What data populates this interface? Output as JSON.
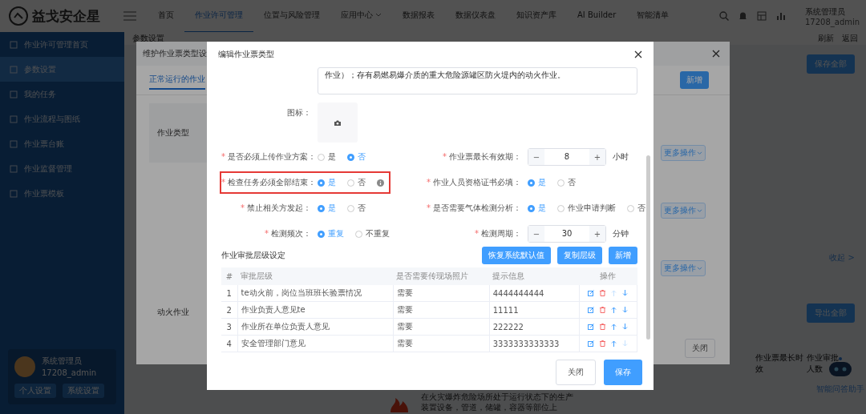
{
  "header": {
    "logo": "益戈安企星",
    "nav": [
      {
        "label": "首页",
        "selected": false,
        "dropdown": false
      },
      {
        "label": "作业许可管理",
        "selected": true,
        "dropdown": false
      },
      {
        "label": "位置与风险管理",
        "selected": false,
        "dropdown": false
      },
      {
        "label": "应用中心",
        "selected": false,
        "dropdown": true
      },
      {
        "label": "数据报表",
        "selected": false,
        "dropdown": false
      },
      {
        "label": "数据仪表盘",
        "selected": false,
        "dropdown": false
      },
      {
        "label": "知识资产库",
        "selected": false,
        "dropdown": false
      },
      {
        "label": "AI Builder",
        "selected": false,
        "dropdown": false
      },
      {
        "label": "智能清单",
        "selected": false,
        "dropdown": false
      }
    ],
    "user": {
      "name": "系统管理员",
      "account": "17208_admin"
    }
  },
  "sidebar": {
    "items": [
      {
        "label": "作业许可管理首页",
        "selected": false
      },
      {
        "label": "参数设置",
        "selected": true
      },
      {
        "label": "我的任务",
        "selected": false
      },
      {
        "label": "作业流程与图纸",
        "selected": false
      },
      {
        "label": "作业票台账",
        "selected": false
      },
      {
        "label": "作业监督管理",
        "selected": false
      },
      {
        "label": "作业票模板",
        "selected": false
      }
    ],
    "profile": {
      "name": "系统管理员",
      "account": "17208_admin",
      "links": [
        "个人设置",
        "系统设置"
      ]
    }
  },
  "page": {
    "breadcrumb": "参数设置",
    "actions": [
      "刷新",
      "返回"
    ],
    "save_all": "保存全部",
    "collapse": "收起 >",
    "export_all": "导出全部",
    "columns": [
      "作业票最长时效",
      "作业审批人数"
    ],
    "description": "在火灾爆炸危险场所处于运行状态下的生产装置设备，管道，储罐，容器等部位上",
    "assistant": "智能问答助手"
  },
  "type_dialog": {
    "title": "维护作业票类型设",
    "tab": "正常运行的作业",
    "add": "新增",
    "header_cell": "作业类型",
    "row_label": "动火作业",
    "more_actions": [
      "更多操作",
      "更多操作",
      "更多操作"
    ],
    "close": "关闭"
  },
  "edit_dialog": {
    "title": "编辑作业票类型",
    "description": "作业）；存有易燃易爆介质的重大危险源罐区防火堤内的动火作业。",
    "icon_label": "图标：",
    "required_mark": "*",
    "stepper_minus": "−",
    "stepper_plus": "+",
    "fields": [
      {
        "kind": "radio",
        "label": "是否必须上传作业方案：",
        "required": true,
        "highlighted": false,
        "info": false,
        "options": [
          {
            "label": "是",
            "selected": false
          },
          {
            "label": "否",
            "selected": true
          }
        ]
      },
      {
        "kind": "stepper",
        "label": "作业票最长有效期：",
        "required": true,
        "highlighted": false,
        "info": false,
        "value": "8",
        "unit": "小时"
      },
      {
        "kind": "radio",
        "label": "检查任务必须全部结束：",
        "required": true,
        "highlighted": true,
        "info": true,
        "options": [
          {
            "label": "是",
            "selected": true
          },
          {
            "label": "否",
            "selected": false
          }
        ]
      },
      {
        "kind": "radio",
        "label": "作业人员资格证书必填：",
        "required": true,
        "highlighted": false,
        "info": false,
        "options": [
          {
            "label": "是",
            "selected": true
          },
          {
            "label": "否",
            "selected": false
          }
        ]
      },
      {
        "kind": "radio",
        "label": "禁止相关方发起：",
        "required": true,
        "highlighted": false,
        "info": false,
        "options": [
          {
            "label": "是",
            "selected": true
          },
          {
            "label": "否",
            "selected": false
          }
        ]
      },
      {
        "kind": "radio",
        "label": "是否需要气体检测分析：",
        "required": true,
        "highlighted": false,
        "info": false,
        "options": [
          {
            "label": "是",
            "selected": true
          },
          {
            "label": "作业申请判断",
            "selected": false
          },
          {
            "label": "否",
            "selected": false
          }
        ]
      },
      {
        "kind": "radio",
        "label": "检测频次：",
        "required": true,
        "highlighted": false,
        "info": false,
        "options": [
          {
            "label": "重复",
            "selected": true
          },
          {
            "label": "不重复",
            "selected": false
          }
        ]
      },
      {
        "kind": "stepper",
        "label": "检测周期：",
        "required": true,
        "highlighted": false,
        "info": false,
        "value": "30",
        "unit": "分钟"
      }
    ],
    "section_title": "作业审批层级设定",
    "section_buttons": [
      "恢复系统默认值",
      "复制层级",
      "新增"
    ],
    "table": {
      "columns": [
        "#",
        "审批层级",
        "是否需要传现场照片",
        "提示信息",
        "操作"
      ],
      "rows": [
        {
          "index": "1",
          "level": "te动火前，岗位当班班长验票情况",
          "photo": "需要",
          "hint": "4444444444",
          "up_disabled": true,
          "down_disabled": false
        },
        {
          "index": "2",
          "level": "作业负责人意见te",
          "photo": "需要",
          "hint": "11111",
          "up_disabled": false,
          "down_disabled": false
        },
        {
          "index": "3",
          "level": "作业所在单位负责人意见",
          "photo": "需要",
          "hint": "222222",
          "up_disabled": false,
          "down_disabled": false
        },
        {
          "index": "4",
          "level": "安全管理部门意见",
          "photo": "需要",
          "hint": "3333333333333",
          "up_disabled": false,
          "down_disabled": true
        }
      ]
    },
    "buttons": [
      {
        "label": "关闭",
        "kind": "plain"
      },
      {
        "label": "保存",
        "kind": "primary"
      }
    ]
  }
}
